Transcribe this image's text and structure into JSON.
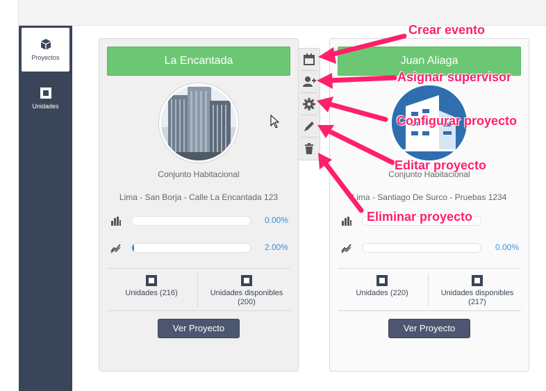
{
  "sidebar": {
    "items": [
      {
        "label": "Proyectos",
        "icon": "cube-icon",
        "active": true
      },
      {
        "label": "Unidades",
        "icon": "square-icon",
        "active": false
      }
    ]
  },
  "projects": [
    {
      "title": "La Encantada",
      "type": "Conjunto Habitacional",
      "address": "Lima - San Borja - Calle La Encantada 123",
      "stat1": {
        "icon": "bar-chart-icon",
        "value": "0.00%",
        "fraction": 0.0
      },
      "stat2": {
        "icon": "trend-icon",
        "value": "2.00%",
        "fraction": 0.02
      },
      "units_label": "Unidades (216)",
      "available_label": "Unidades disponibles (200)",
      "button": "Ver Proyecto",
      "avatar": "building-photo"
    },
    {
      "title": "Juan Aliaga",
      "type": "Conjunto Habitacional",
      "address": "Lima - Santiago De Surco - Pruebas 1234",
      "stat1": {
        "icon": "bar-chart-icon",
        "value": "",
        "fraction": 0.0
      },
      "stat2": {
        "icon": "trend-icon",
        "value": "0.00%",
        "fraction": 0.0
      },
      "units_label": "Unidades (220)",
      "available_label": "Unidades disponibles (217)",
      "button": "Ver Proyecto",
      "avatar": "building-logo"
    }
  ],
  "toolbar": {
    "buttons": [
      "calendar-icon",
      "add-user-icon",
      "gear-icon",
      "pencil-icon",
      "trash-icon"
    ]
  },
  "annotations": {
    "crear": "Crear evento",
    "asignar": "Asignar supervisor",
    "configurar": "Configurar proyecto",
    "editar": "Editar proyecto",
    "eliminar": "Eliminar proyecto"
  },
  "colors": {
    "sidebar": "#3b4559",
    "title_green": "#6cc774",
    "accent_blue": "#3a8fd6",
    "annotation_pink": "#ff1f6b"
  }
}
